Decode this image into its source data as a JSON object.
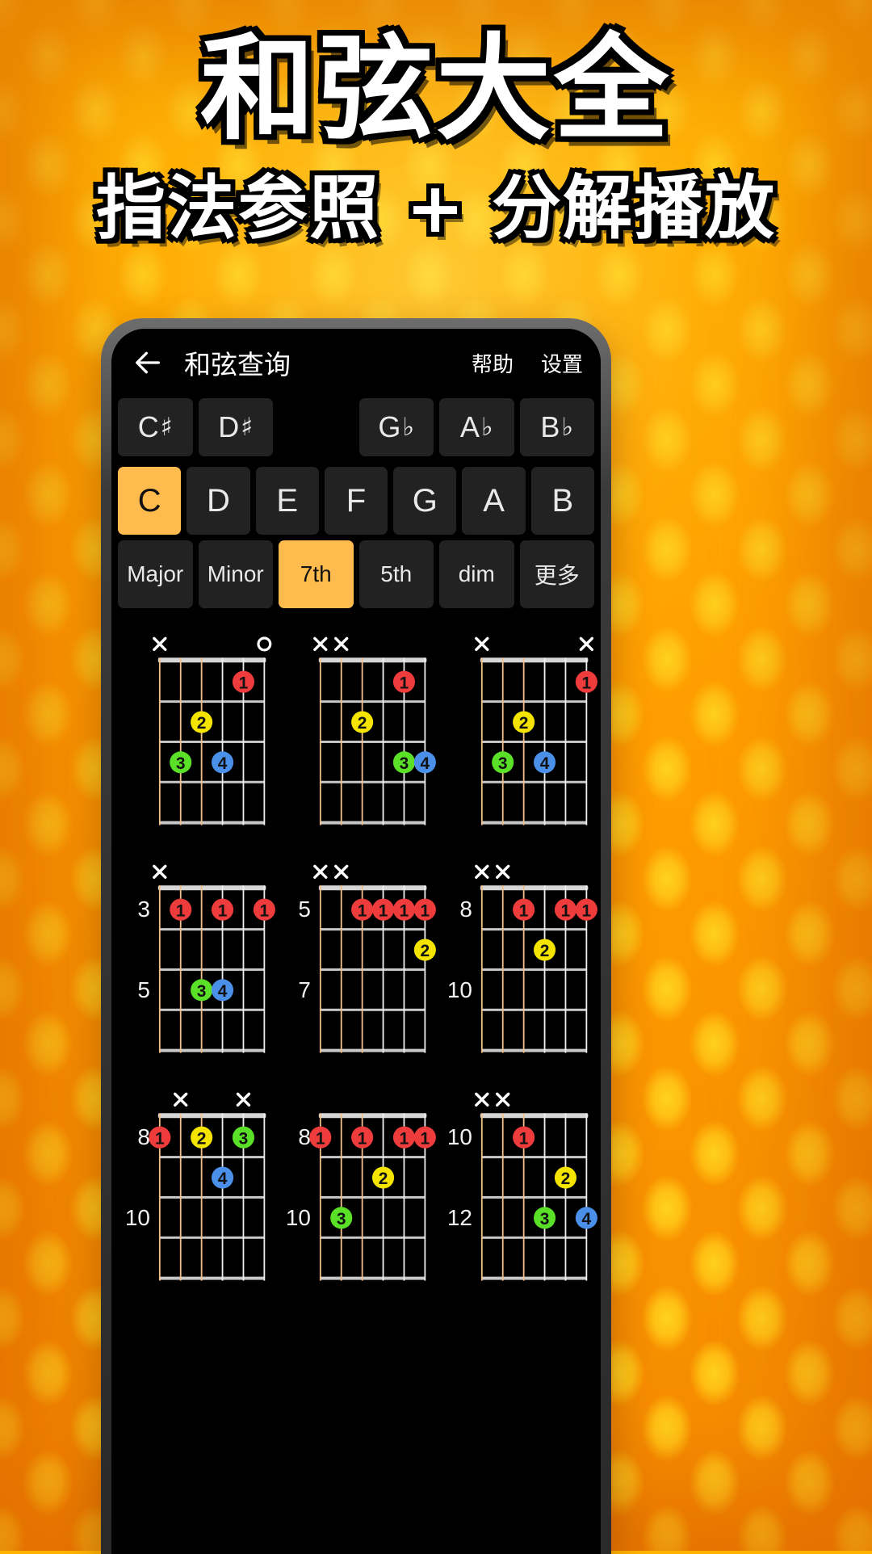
{
  "poster": {
    "headline": "和弦大全",
    "subhead": "指法参照 + 分解播放",
    "bg_color": "#FFA70A",
    "accent_color": "#FFBB4D"
  },
  "appbar": {
    "back_icon": "arrow-left-icon",
    "title": "和弦查询",
    "help_label": "帮助",
    "settings_label": "设置"
  },
  "sharps_row": [
    {
      "label": "C",
      "accidental": "♯",
      "selected": false
    },
    {
      "label": "D",
      "accidental": "♯",
      "selected": false
    },
    {
      "label": "",
      "accidental": "",
      "spacer": true
    },
    {
      "label": "G",
      "accidental": "♭",
      "selected": false
    },
    {
      "label": "A",
      "accidental": "♭",
      "selected": false
    },
    {
      "label": "B",
      "accidental": "♭",
      "selected": false
    }
  ],
  "naturals_row": [
    {
      "label": "C",
      "selected": true
    },
    {
      "label": "D",
      "selected": false
    },
    {
      "label": "E",
      "selected": false
    },
    {
      "label": "F",
      "selected": false
    },
    {
      "label": "G",
      "selected": false
    },
    {
      "label": "A",
      "selected": false
    },
    {
      "label": "B",
      "selected": false
    }
  ],
  "types_row": [
    {
      "label": "Major",
      "selected": false
    },
    {
      "label": "Minor",
      "selected": false
    },
    {
      "label": "7th",
      "selected": true
    },
    {
      "label": "5th",
      "selected": false
    },
    {
      "label": "dim",
      "selected": false
    },
    {
      "label": "更多",
      "selected": false
    }
  ],
  "finger_colors": {
    "1": "#EE3B3B",
    "2": "#F5E400",
    "3": "#5BE028",
    "4": "#4A90E8"
  },
  "chord_diagrams": [
    {
      "index": 0,
      "open_markers": [
        {
          "string": 1,
          "mark": "X"
        },
        {
          "string": 6,
          "mark": "O"
        }
      ],
      "fret_labels": [],
      "nut": true,
      "dots": [
        {
          "string": 5,
          "fret": 1,
          "finger": "1"
        },
        {
          "string": 3,
          "fret": 2,
          "finger": "2"
        },
        {
          "string": 2,
          "fret": 3,
          "finger": "3"
        },
        {
          "string": 4,
          "fret": 3,
          "finger": "4"
        }
      ]
    },
    {
      "index": 1,
      "open_markers": [
        {
          "string": 1,
          "mark": "X"
        },
        {
          "string": 2,
          "mark": "X"
        }
      ],
      "fret_labels": [],
      "nut": true,
      "dots": [
        {
          "string": 5,
          "fret": 1,
          "finger": "1"
        },
        {
          "string": 3,
          "fret": 2,
          "finger": "2"
        },
        {
          "string": 5,
          "fret": 3,
          "finger": "3"
        },
        {
          "string": 6,
          "fret": 3,
          "finger": "4"
        }
      ]
    },
    {
      "index": 2,
      "open_markers": [
        {
          "string": 1,
          "mark": "X"
        },
        {
          "string": 6,
          "mark": "X"
        }
      ],
      "fret_labels": [],
      "nut": true,
      "dots": [
        {
          "string": 6,
          "fret": 1,
          "finger": "1"
        },
        {
          "string": 3,
          "fret": 2,
          "finger": "2"
        },
        {
          "string": 2,
          "fret": 3,
          "finger": "3"
        },
        {
          "string": 4,
          "fret": 3,
          "finger": "4"
        }
      ]
    },
    {
      "index": 3,
      "open_markers": [
        {
          "string": 1,
          "mark": "X"
        }
      ],
      "fret_labels": [
        {
          "fret_row": 1,
          "text": "3"
        },
        {
          "fret_row": 3,
          "text": "5"
        }
      ],
      "nut": false,
      "dots": [
        {
          "string": 2,
          "fret": 1,
          "finger": "1"
        },
        {
          "string": 4,
          "fret": 1,
          "finger": "1"
        },
        {
          "string": 6,
          "fret": 1,
          "finger": "1"
        },
        {
          "string": 3,
          "fret": 3,
          "finger": "3"
        },
        {
          "string": 4,
          "fret": 3,
          "finger": "4"
        }
      ]
    },
    {
      "index": 4,
      "open_markers": [
        {
          "string": 1,
          "mark": "X"
        },
        {
          "string": 2,
          "mark": "X"
        }
      ],
      "fret_labels": [
        {
          "fret_row": 1,
          "text": "5"
        },
        {
          "fret_row": 3,
          "text": "7"
        }
      ],
      "nut": false,
      "dots": [
        {
          "string": 3,
          "fret": 1,
          "finger": "1"
        },
        {
          "string": 4,
          "fret": 1,
          "finger": "1"
        },
        {
          "string": 5,
          "fret": 1,
          "finger": "1"
        },
        {
          "string": 6,
          "fret": 1,
          "finger": "1"
        },
        {
          "string": 6,
          "fret": 2,
          "finger": "2"
        }
      ]
    },
    {
      "index": 5,
      "open_markers": [
        {
          "string": 1,
          "mark": "X"
        },
        {
          "string": 2,
          "mark": "X"
        }
      ],
      "fret_labels": [
        {
          "fret_row": 1,
          "text": "8"
        },
        {
          "fret_row": 3,
          "text": "10"
        }
      ],
      "nut": false,
      "dots": [
        {
          "string": 3,
          "fret": 1,
          "finger": "1"
        },
        {
          "string": 5,
          "fret": 1,
          "finger": "1"
        },
        {
          "string": 6,
          "fret": 1,
          "finger": "1"
        },
        {
          "string": 4,
          "fret": 2,
          "finger": "2"
        }
      ]
    },
    {
      "index": 6,
      "open_markers": [
        {
          "string": 2,
          "mark": "X"
        },
        {
          "string": 5,
          "mark": "X"
        }
      ],
      "fret_labels": [
        {
          "fret_row": 1,
          "text": "8"
        },
        {
          "fret_row": 3,
          "text": "10"
        }
      ],
      "nut": false,
      "dots": [
        {
          "string": 1,
          "fret": 1,
          "finger": "1"
        },
        {
          "string": 3,
          "fret": 1,
          "finger": "2"
        },
        {
          "string": 5,
          "fret": 1,
          "finger": "3"
        },
        {
          "string": 4,
          "fret": 2,
          "finger": "4"
        }
      ]
    },
    {
      "index": 7,
      "open_markers": [],
      "fret_labels": [
        {
          "fret_row": 1,
          "text": "8"
        },
        {
          "fret_row": 3,
          "text": "10"
        }
      ],
      "nut": false,
      "dots": [
        {
          "string": 1,
          "fret": 1,
          "finger": "1"
        },
        {
          "string": 3,
          "fret": 1,
          "finger": "1"
        },
        {
          "string": 5,
          "fret": 1,
          "finger": "1"
        },
        {
          "string": 6,
          "fret": 1,
          "finger": "1"
        },
        {
          "string": 4,
          "fret": 2,
          "finger": "2"
        },
        {
          "string": 2,
          "fret": 3,
          "finger": "3"
        }
      ]
    },
    {
      "index": 8,
      "open_markers": [
        {
          "string": 1,
          "mark": "X"
        },
        {
          "string": 2,
          "mark": "X"
        }
      ],
      "fret_labels": [
        {
          "fret_row": 1,
          "text": "10"
        },
        {
          "fret_row": 3,
          "text": "12"
        }
      ],
      "nut": false,
      "dots": [
        {
          "string": 3,
          "fret": 1,
          "finger": "1"
        },
        {
          "string": 5,
          "fret": 2,
          "finger": "2"
        },
        {
          "string": 4,
          "fret": 3,
          "finger": "3"
        },
        {
          "string": 6,
          "fret": 3,
          "finger": "4"
        }
      ]
    }
  ]
}
